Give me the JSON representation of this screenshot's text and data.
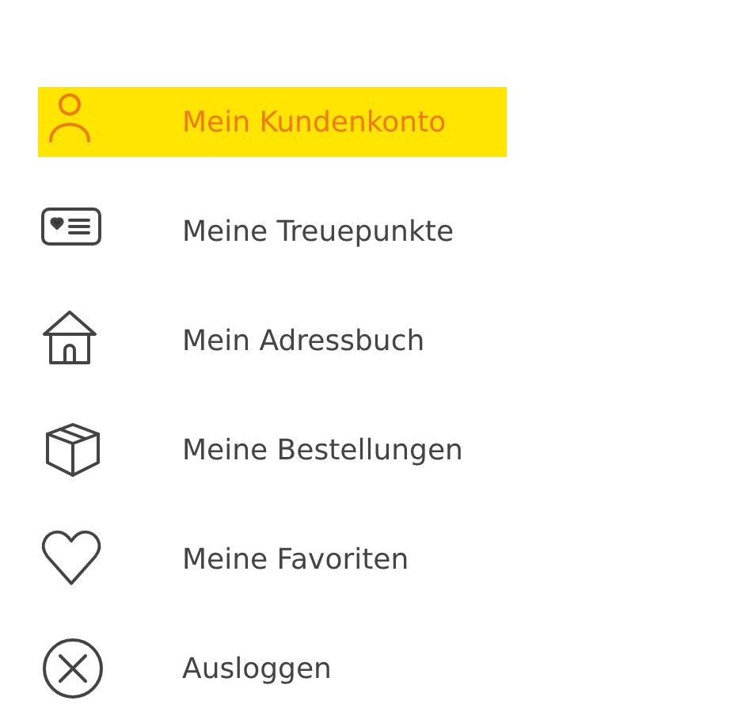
{
  "menu": [
    {
      "label": "Mein Kundenkonto",
      "kind": "account",
      "selected": true
    },
    {
      "label": "Meine Treuepunkte",
      "kind": "points",
      "selected": false
    },
    {
      "label": "Mein Adressbuch",
      "kind": "addresses",
      "selected": false
    },
    {
      "label": "Meine Bestellungen",
      "kind": "orders",
      "selected": false
    },
    {
      "label": "Meine Favoriten",
      "kind": "favorites",
      "selected": false
    },
    {
      "label": "Ausloggen",
      "kind": "logout",
      "selected": false
    }
  ]
}
